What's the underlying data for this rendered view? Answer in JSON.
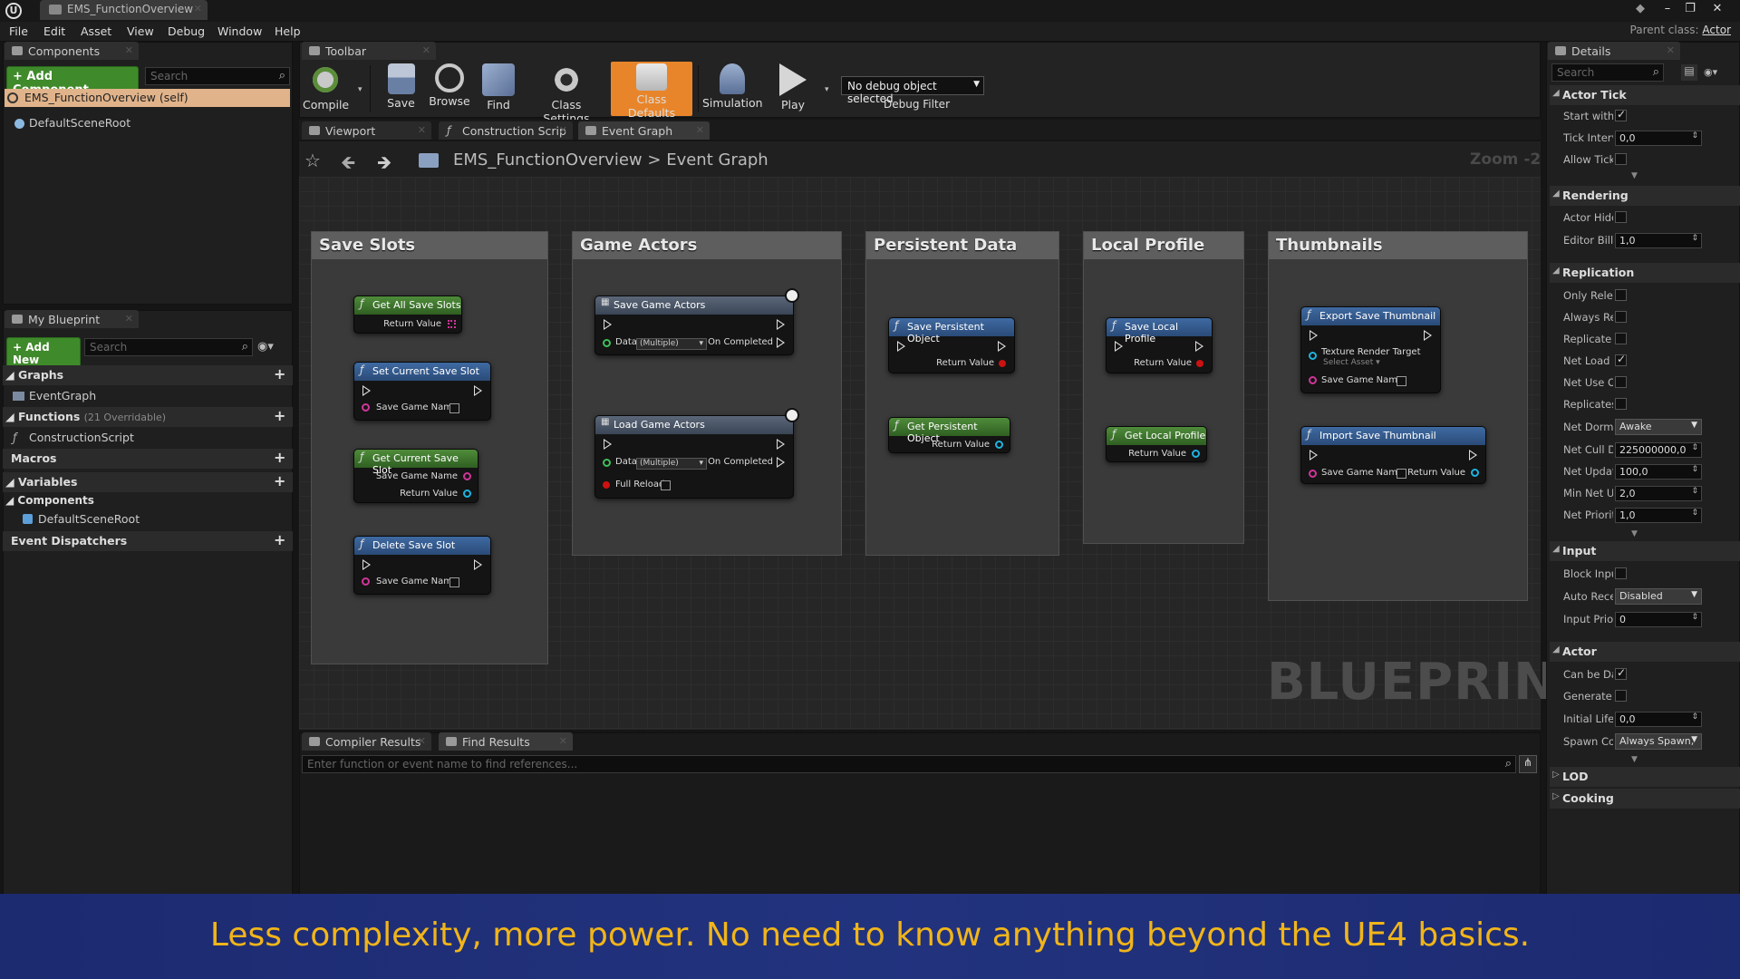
{
  "window": {
    "doc_tab": "EMS_FunctionOverview",
    "parent_class_label": "Parent class:",
    "parent_class_value": "Actor"
  },
  "menu": [
    "File",
    "Edit",
    "Asset",
    "View",
    "Debug",
    "Window",
    "Help"
  ],
  "components_panel": {
    "tab": "Components",
    "add_button": "+ Add Component",
    "search_placeholder": "Search",
    "self_item": "EMS_FunctionOverview (self)",
    "root_item": "DefaultSceneRoot"
  },
  "my_blueprint": {
    "tab": "My Blueprint",
    "add_button": "+ Add New",
    "search_placeholder": "Search",
    "graphs_label": "Graphs",
    "graph_item": "EventGraph",
    "functions_label": "Functions",
    "functions_count": "(21 Overridable)",
    "function_item": "ConstructionScript",
    "macros_label": "Macros",
    "variables_label": "Variables",
    "components_label": "Components",
    "component_item": "DefaultSceneRoot",
    "dispatchers_label": "Event Dispatchers"
  },
  "toolbar": {
    "tab": "Toolbar",
    "compile": "Compile",
    "save": "Save",
    "browse": "Browse",
    "find": "Find",
    "class_settings": "Class Settings",
    "class_defaults": "Class Defaults",
    "simulation": "Simulation",
    "play": "Play",
    "debug_select": "No debug object selected",
    "debug_filter": "Debug Filter"
  },
  "editor_tabs": {
    "viewport": "Viewport",
    "construction": "Construction Scrip",
    "event_graph": "Event Graph"
  },
  "breadcrumb": {
    "root": "EMS_FunctionOverview",
    "separator": ">",
    "current": "Event Graph",
    "zoom": "Zoom -2"
  },
  "comments": {
    "save_slots": "Save Slots",
    "game_actors": "Game Actors",
    "persistent_data": "Persistent Data",
    "local_profile": "Local Profile",
    "thumbnails": "Thumbnails"
  },
  "nodes": {
    "get_all_save_slots": "Get All Save Slots",
    "set_current_save_slot": "Set Current Save Slot",
    "get_current_save_slot": "Get Current Save Slot",
    "delete_save_slot": "Delete Save Slot",
    "save_game_actors": "Save Game Actors",
    "load_game_actors": "Load Game Actors",
    "save_persistent_object": "Save Persistent Object",
    "get_persistent_object": "Get Persistent Object",
    "save_local_profile": "Save Local Profile",
    "get_local_profile": "Get Local Profile",
    "export_save_thumbnail": "Export Save Thumbnail",
    "import_save_thumbnail": "Import Save Thumbnail"
  },
  "pins": {
    "return_value": "Return Value",
    "save_game_name": "Save Game Name",
    "data": "Data",
    "multiple": "(Multiple)",
    "on_completed": "On Completed",
    "full_reload": "Full Reload",
    "texture_render_target": "Texture Render Target",
    "select_asset": "Select Asset"
  },
  "watermark": "BLUEPRINT",
  "bottom_panel": {
    "compiler_results": "Compiler Results",
    "find_results": "Find Results",
    "find_placeholder": "Enter function or event name to find references..."
  },
  "details": {
    "tab": "Details",
    "search_placeholder": "Search",
    "actor_tick": "Actor Tick",
    "start_with": "Start with",
    "tick_interval": "Tick Interv",
    "tick_interval_val": "0,0",
    "allow_tick": "Allow Tick",
    "rendering": "Rendering",
    "actor_hidden": "Actor Hidc",
    "editor_billboard": "Editor Bill",
    "editor_billboard_val": "1,0",
    "replication": "Replication",
    "only_relevant": "Only Relev",
    "always_relevant": "Always Re",
    "replicate": "Replicate",
    "net_load": "Net Load c",
    "net_use_owner": "Net Use O",
    "replicates": "Replicates",
    "net_dormancy": "Net Dorm:",
    "net_dormancy_val": "Awake",
    "net_cull": "Net Cull D",
    "net_cull_val": "225000000,0",
    "net_update": "Net Updat",
    "net_update_val": "100,0",
    "min_net": "Min Net U",
    "min_net_val": "2,0",
    "net_priority": "Net Priorit",
    "net_priority_val": "1,0",
    "input": "Input",
    "block_input": "Block Inpu",
    "auto_receive": "Auto Rece",
    "auto_receive_val": "Disabled",
    "input_priority": "Input Prior",
    "input_priority_val": "0",
    "actor": "Actor",
    "can_be_damaged": "Can be Da",
    "generate": "Generate (",
    "initial_life": "Initial Life",
    "initial_life_val": "0,0",
    "spawn_col": "Spawn Col",
    "spawn_col_val": "Always Spawn,",
    "lod": "LOD",
    "cooking": "Cooking"
  },
  "banner": "Less complexity, more power. No need to know anything beyond the UE4 basics.",
  "colors": {
    "accent_orange": "#e8852a",
    "add_green": "#3f8a2a",
    "node_header_blue": "#3f6aa2",
    "banner_blue": "#1d2a6e",
    "banner_text": "#f1b51a"
  }
}
